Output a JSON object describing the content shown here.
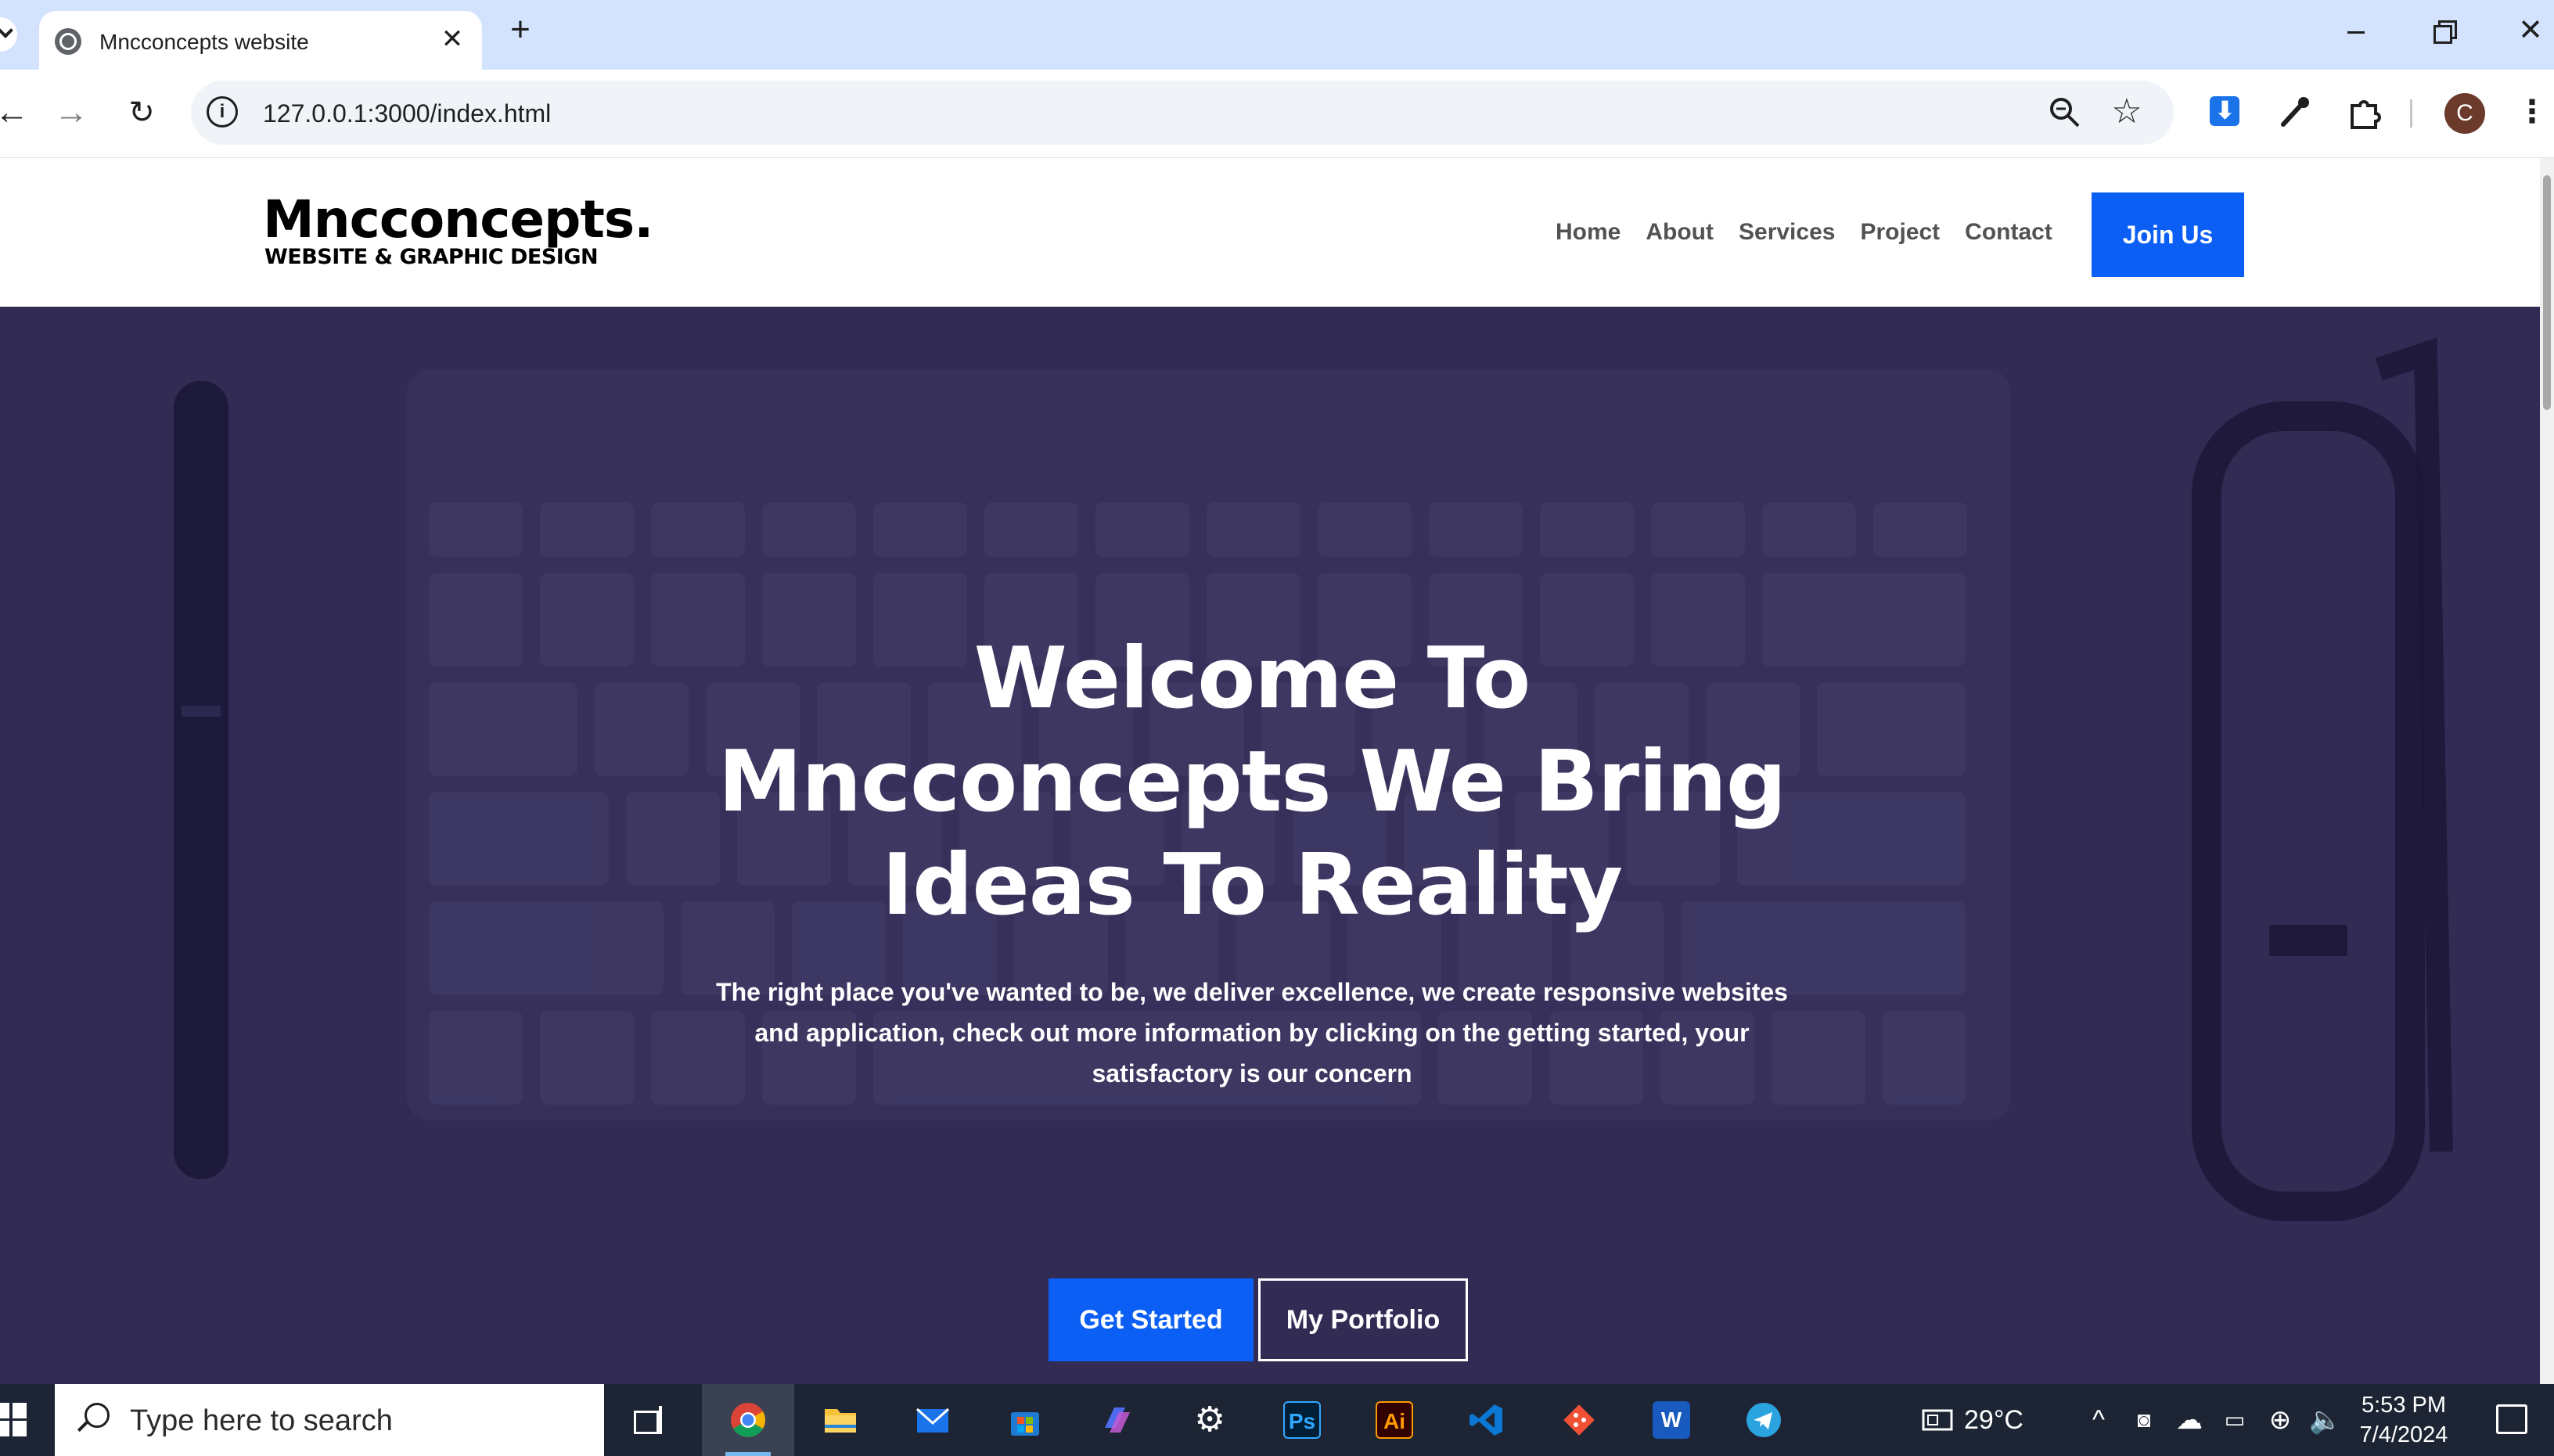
{
  "browser": {
    "tab_title": "Mncconcepts website",
    "tab_close": "✕",
    "new_tab": "+",
    "url": "127.0.0.1:3000/index.html",
    "profile_initial": "C",
    "window_controls": {
      "close": "✕"
    },
    "icons": [
      "back-arrow-icon",
      "forward-arrow-icon",
      "reload-icon",
      "site-info-icon",
      "zoom-icon",
      "bookmark-star-icon",
      "download-icon",
      "eyedropper-icon",
      "extensions-icon",
      "kebab-menu-icon"
    ]
  },
  "site": {
    "logo_main": "Mncconcepts.",
    "logo_sub": "WEBSITE & GRAPHIC DESIGN",
    "nav": [
      "Home",
      "About",
      "Services",
      "Project",
      "Contact"
    ],
    "join_label": "Join Us",
    "hero_title_lines": [
      "Welcome To",
      "Mncconcepts We Bring",
      "Ideas To Reality"
    ],
    "hero_desc_lines": [
      "The right place you've wanted to be, we deliver excellence, we create responsive websites",
      "and application, check out more information by clicking on the getting started, your",
      "satisfactory is our concern"
    ],
    "cta_primary": "Get Started",
    "cta_secondary": "My Portfolio",
    "colors": {
      "accent": "#0b5ff5",
      "hero_overlay": "#322c55",
      "nav_text": "#525252"
    }
  },
  "taskbar": {
    "search_placeholder": "Type here to search",
    "apps": [
      "Chrome",
      "File Explorer",
      "Mail",
      "Microsoft Store",
      "Copilot",
      "Settings",
      "Photoshop",
      "Illustrator",
      "VS Code",
      "Git",
      "Word",
      "Telegram"
    ],
    "app_glyphs": {
      "photoshop": "Ps",
      "illustrator": "Ai",
      "word": "W"
    },
    "temperature": "29°C",
    "time": "5:53 PM",
    "date": "7/4/2024"
  }
}
